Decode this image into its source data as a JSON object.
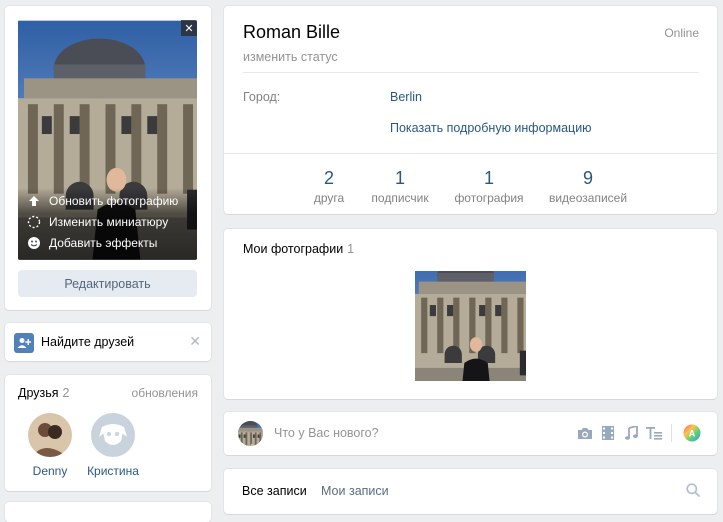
{
  "avatar": {
    "menu": {
      "update_photo": "Обновить фотографию",
      "change_thumb": "Изменить миниатюру",
      "add_effects": "Добавить эффекты"
    },
    "close_symbol": "✕",
    "edit_label": "Редактировать"
  },
  "find_friends": {
    "label": "Найдите друзей",
    "close_symbol": "✕"
  },
  "friends": {
    "title": "Друзья",
    "count": "2",
    "updates": "обновления",
    "items": [
      {
        "name": "Denny"
      },
      {
        "name": "Кристина"
      }
    ]
  },
  "profile": {
    "name": "Roman Bille",
    "status_prompt": "изменить статус",
    "online": "Online",
    "city_label": "Город:",
    "city_value": "Berlin",
    "more_info": "Показать подробную информацию",
    "stats": [
      {
        "value": "2",
        "label": "друга"
      },
      {
        "value": "1",
        "label": "подписчик"
      },
      {
        "value": "1",
        "label": "фотография"
      },
      {
        "value": "9",
        "label": "видеозаписей"
      }
    ]
  },
  "photos": {
    "title": "Мои фотографии",
    "count": "1"
  },
  "post": {
    "placeholder": "Что у Вас нового?",
    "tools": [
      "camera-icon",
      "video-icon",
      "music-icon",
      "text-format-icon",
      "poster-icon"
    ]
  },
  "wall": {
    "tab_all": "Все записи",
    "tab_mine": "Мои записи"
  },
  "colors": {
    "link": "#2a5885",
    "muted": "#939393",
    "accent": "#5181b8",
    "background": "#edeef0"
  }
}
